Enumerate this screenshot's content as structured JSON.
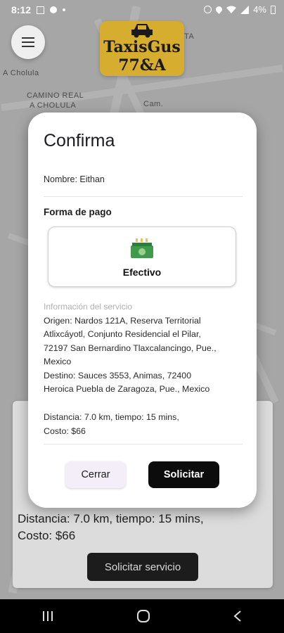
{
  "status_bar": {
    "time": "8:12",
    "battery": "4%"
  },
  "app": {
    "logo_line1": "TaxisGus",
    "logo_line2": "77&A"
  },
  "map_labels": [
    "CAMINO REAL",
    "A CHOLULA",
    "A Cholula",
    "Cam.",
    "TA"
  ],
  "background_card": {
    "line1": "Distancia: 7.0 km, tiempo: 15 mins,",
    "line2": "Costo: $66",
    "button": "Solicitar servicio"
  },
  "dialog": {
    "title": "Confirma",
    "name_line": "Nombre: Eithan",
    "payment_heading": "Forma de pago",
    "payment_method": "Efectivo",
    "info_heading": "Información del servicio",
    "origin_lines": [
      "Origen: Nardos 121A, Reserva Territorial",
      "Atlixcáyotl, Conjunto Residencial el Pilar,",
      "72197 San Bernardino Tlaxcalancingo, Pue.,",
      "Mexico"
    ],
    "destination_lines": [
      "Destino: Sauces 3553, Animas, 72400",
      "Heroica Puebla de Zaragoza, Pue., Mexico"
    ],
    "summary_lines": [
      "Distancia: 7.0 km, tiempo: 15 mins,",
      "Costo: $66"
    ],
    "close_button": "Cerrar",
    "request_button": "Solicitar"
  },
  "colors": {
    "logo_bg": "#d6ad2e",
    "primary_button": "#0c0c0c",
    "secondary_button": "#f3eef7"
  }
}
